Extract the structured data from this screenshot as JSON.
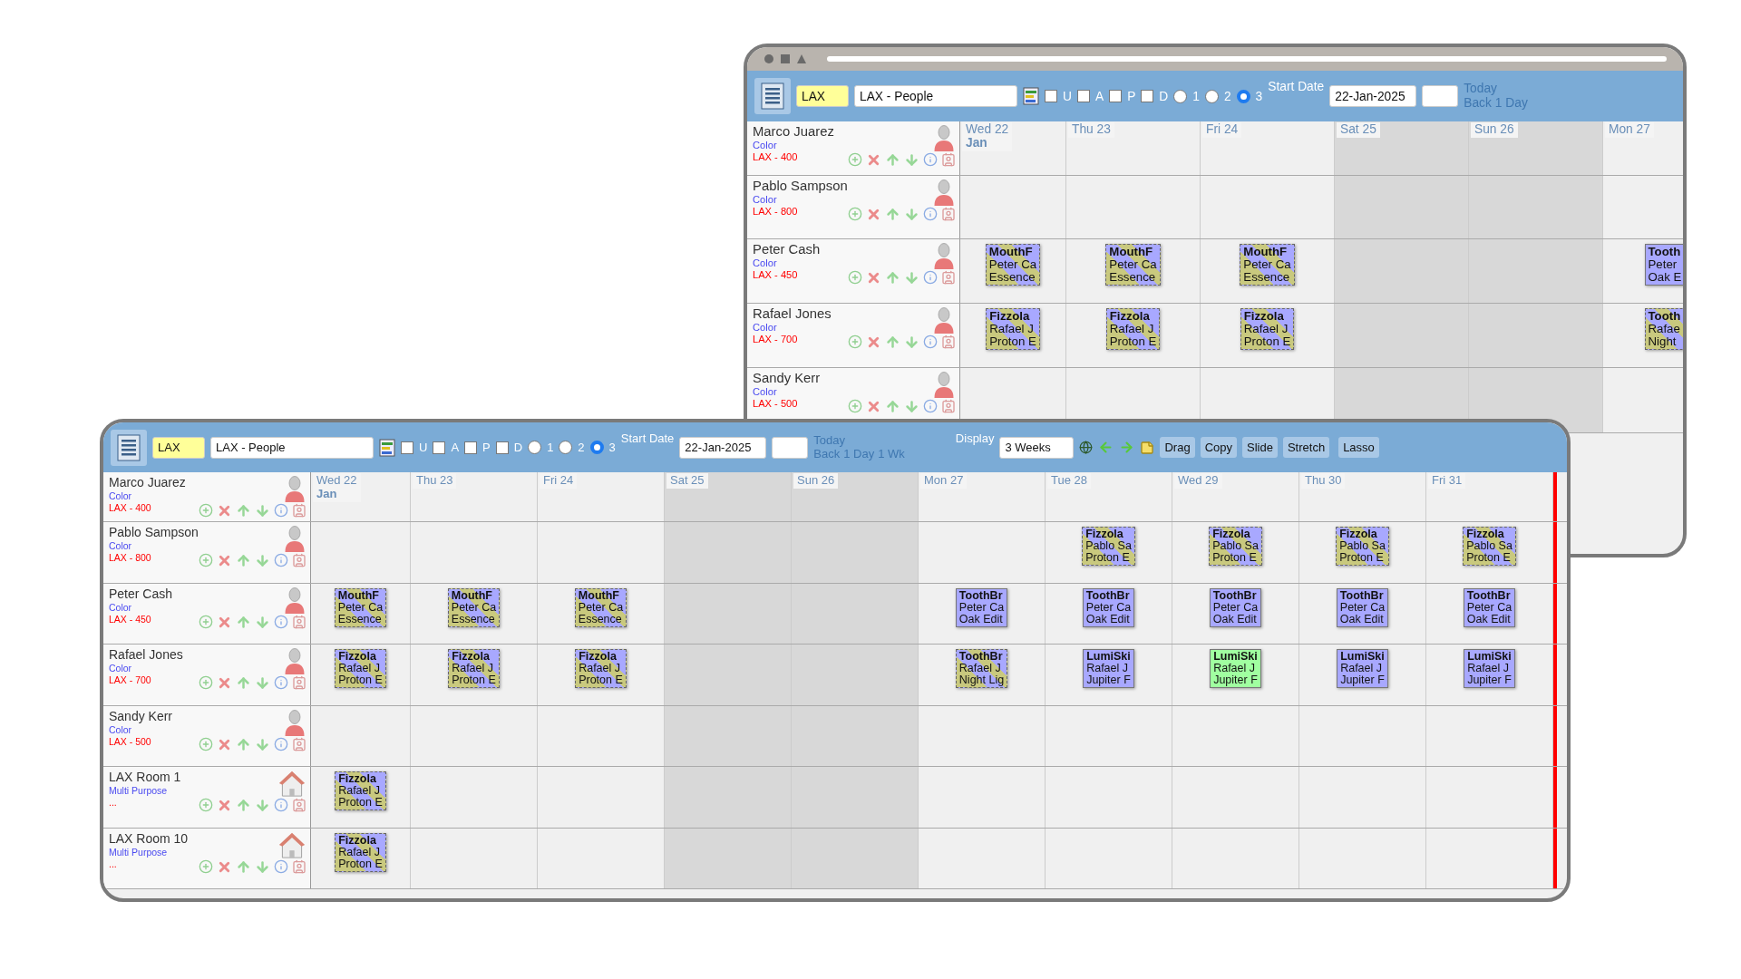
{
  "windows": [
    {
      "title_bar": true,
      "toolbar": {
        "code": "LAX",
        "view": "LAX - People",
        "filters": [
          {
            "label": "U",
            "checked": false
          },
          {
            "label": "A",
            "checked": false
          },
          {
            "label": "P",
            "checked": false
          },
          {
            "label": "D",
            "checked": false
          }
        ],
        "radios": [
          {
            "label": "1",
            "selected": false
          },
          {
            "label": "2",
            "selected": false
          },
          {
            "label": "3",
            "selected": true
          }
        ],
        "start_label": "Start Date",
        "start_date": "22-Jan-2025",
        "today_link": "Today",
        "back_links": [
          "Back",
          "1 Day"
        ]
      },
      "days": [
        {
          "label": "Wed 22",
          "month": "Jan",
          "weekend": false
        },
        {
          "label": "Thu 23",
          "weekend": false
        },
        {
          "label": "Fri 24",
          "weekend": false
        },
        {
          "label": "Sat 25",
          "weekend": true
        },
        {
          "label": "Sun 26",
          "weekend": true
        },
        {
          "label": "Mon 27",
          "weekend": false
        }
      ],
      "rows": [
        {
          "name": "Marco Juarez",
          "sub": "Color",
          "tag": "LAX - 400",
          "kind": "person",
          "slots": [
            {
              "kind": "none"
            },
            {
              "kind": "none"
            },
            {
              "kind": "none"
            },
            {
              "kind": "none"
            },
            {
              "kind": "none"
            },
            {
              "kind": "none"
            }
          ]
        },
        {
          "name": "Pablo Sampson",
          "sub": "Color",
          "tag": "LAX - 800",
          "kind": "person",
          "slots": [
            {
              "kind": "none"
            },
            {
              "kind": "none"
            },
            {
              "kind": "none"
            },
            {
              "kind": "none"
            },
            {
              "kind": "none"
            },
            {
              "kind": "none"
            }
          ]
        },
        {
          "name": "Peter Cash",
          "sub": "Color",
          "tag": "LAX - 450",
          "kind": "person",
          "slots": [
            {
              "lines": [
                "MouthF",
                "Peter Ca",
                "Essence"
              ],
              "kind": "striped"
            },
            {
              "lines": [
                "MouthF",
                "Peter Ca",
                "Essence"
              ],
              "kind": "striped"
            },
            {
              "lines": [
                "MouthF",
                "Peter Ca",
                "Essence"
              ],
              "kind": "striped"
            },
            {
              "kind": "none"
            },
            {
              "kind": "none"
            },
            {
              "lines": [
                "Tooth",
                "Peter",
                "Oak E"
              ],
              "kind": "solid",
              "color": "#a8a8ff"
            }
          ]
        },
        {
          "name": "Rafael Jones",
          "sub": "Color",
          "tag": "LAX - 700",
          "kind": "person",
          "slots": [
            {
              "lines": [
                "Fizzola",
                "Rafael J",
                "Proton E"
              ],
              "kind": "striped"
            },
            {
              "lines": [
                "Fizzola",
                "Rafael J",
                "Proton E"
              ],
              "kind": "striped"
            },
            {
              "lines": [
                "Fizzola",
                "Rafael J",
                "Proton E"
              ],
              "kind": "striped"
            },
            {
              "kind": "none"
            },
            {
              "kind": "none"
            },
            {
              "lines": [
                "Tooth",
                "Rafae",
                "Night"
              ],
              "kind": "striped"
            }
          ]
        },
        {
          "name": "Sandy Kerr",
          "sub": "Color",
          "tag": "LAX - 500",
          "kind": "person",
          "slots": [
            {
              "kind": "none"
            },
            {
              "kind": "none"
            },
            {
              "kind": "none"
            },
            {
              "kind": "none"
            },
            {
              "kind": "none"
            },
            {
              "kind": "none"
            }
          ]
        }
      ]
    },
    {
      "toolbar": {
        "code": "LAX",
        "view": "LAX - People",
        "filters": [
          {
            "label": "U",
            "checked": false
          },
          {
            "label": "A",
            "checked": false
          },
          {
            "label": "P",
            "checked": false
          },
          {
            "label": "D",
            "checked": false
          }
        ],
        "radios": [
          {
            "label": "1",
            "selected": false
          },
          {
            "label": "2",
            "selected": false
          },
          {
            "label": "3",
            "selected": true
          }
        ],
        "start_label": "Start Date",
        "start_date": "22-Jan-2025",
        "today_link": "Today",
        "back_links": [
          "Back",
          "1 Day",
          "1 Wk"
        ],
        "display_label": "Display",
        "display_value": "3 Weeks",
        "buttons": [
          "Drag",
          "Copy",
          "Slide",
          "Stretch",
          "Lasso"
        ]
      },
      "days": [
        {
          "label": "Wed 22",
          "month": "Jan",
          "weekend": false
        },
        {
          "label": "Thu 23",
          "weekend": false
        },
        {
          "label": "Fri 24",
          "weekend": false
        },
        {
          "label": "Sat 25",
          "weekend": true
        },
        {
          "label": "Sun 26",
          "weekend": true
        },
        {
          "label": "Mon 27",
          "weekend": false
        },
        {
          "label": "Tue 28",
          "weekend": false
        },
        {
          "label": "Wed 29",
          "weekend": false
        },
        {
          "label": "Thu 30",
          "weekend": false
        },
        {
          "label": "Fri 31",
          "weekend": false
        }
      ],
      "rows": [
        {
          "name": "Marco Juarez",
          "sub": "Color",
          "tag": "LAX - 400",
          "kind": "person",
          "slots": [
            {
              "kind": "none"
            },
            {
              "kind": "none"
            },
            {
              "kind": "none"
            },
            {
              "kind": "none"
            },
            {
              "kind": "none"
            },
            {
              "kind": "none"
            },
            {
              "kind": "none"
            },
            {
              "kind": "none"
            },
            {
              "kind": "none"
            },
            {
              "kind": "none"
            }
          ]
        },
        {
          "name": "Pablo Sampson",
          "sub": "Color",
          "tag": "LAX - 800",
          "kind": "person",
          "slots": [
            {
              "kind": "none"
            },
            {
              "kind": "none"
            },
            {
              "kind": "none"
            },
            {
              "kind": "none"
            },
            {
              "kind": "none"
            },
            {
              "kind": "none"
            },
            {
              "lines": [
                "Fizzola",
                "Pablo Sa",
                "Proton E"
              ],
              "kind": "striped"
            },
            {
              "lines": [
                "Fizzola",
                "Pablo Sa",
                "Proton E"
              ],
              "kind": "striped"
            },
            {
              "lines": [
                "Fizzola",
                "Pablo Sa",
                "Proton E"
              ],
              "kind": "striped"
            },
            {
              "lines": [
                "Fizzola",
                "Pablo Sa",
                "Proton E"
              ],
              "kind": "striped"
            }
          ]
        },
        {
          "name": "Peter Cash",
          "sub": "Color",
          "tag": "LAX - 450",
          "kind": "person",
          "slots": [
            {
              "lines": [
                "MouthF",
                "Peter Ca",
                "Essence"
              ],
              "kind": "striped"
            },
            {
              "lines": [
                "MouthF",
                "Peter Ca",
                "Essence"
              ],
              "kind": "striped"
            },
            {
              "lines": [
                "MouthF",
                "Peter Ca",
                "Essence"
              ],
              "kind": "striped"
            },
            {
              "kind": "none"
            },
            {
              "kind": "none"
            },
            {
              "lines": [
                "ToothBr",
                "Peter Ca",
                "Oak Edit"
              ],
              "kind": "solid",
              "color": "#a8a8ff"
            },
            {
              "lines": [
                "ToothBr",
                "Peter Ca",
                "Oak Edit"
              ],
              "kind": "solid",
              "color": "#a8a8ff"
            },
            {
              "lines": [
                "ToothBr",
                "Peter Ca",
                "Oak Edit"
              ],
              "kind": "solid",
              "color": "#a8a8ff"
            },
            {
              "lines": [
                "ToothBr",
                "Peter Ca",
                "Oak Edit"
              ],
              "kind": "solid",
              "color": "#a8a8ff"
            },
            {
              "lines": [
                "ToothBr",
                "Peter Ca",
                "Oak Edit"
              ],
              "kind": "solid",
              "color": "#a8a8ff"
            }
          ]
        },
        {
          "name": "Rafael Jones",
          "sub": "Color",
          "tag": "LAX - 700",
          "kind": "person",
          "slots": [
            {
              "lines": [
                "Fizzola",
                "Rafael J",
                "Proton E"
              ],
              "kind": "striped"
            },
            {
              "lines": [
                "Fizzola",
                "Rafael J",
                "Proton E"
              ],
              "kind": "striped"
            },
            {
              "lines": [
                "Fizzola",
                "Rafael J",
                "Proton E"
              ],
              "kind": "striped"
            },
            {
              "kind": "none"
            },
            {
              "kind": "none"
            },
            {
              "lines": [
                "ToothBr",
                "Rafael J",
                "Night Lig"
              ],
              "kind": "striped"
            },
            {
              "lines": [
                "LumiSki",
                "Rafael J",
                "Jupiter F"
              ],
              "kind": "solid",
              "color": "#a8a8ff"
            },
            {
              "lines": [
                "LumiSki",
                "Rafael J",
                "Jupiter F"
              ],
              "kind": "solid",
              "color": "#a0ffa0"
            },
            {
              "lines": [
                "LumiSki",
                "Rafael J",
                "Jupiter F"
              ],
              "kind": "solid",
              "color": "#a8a8ff"
            },
            {
              "lines": [
                "LumiSki",
                "Rafael J",
                "Jupiter F"
              ],
              "kind": "solid",
              "color": "#a8a8ff"
            }
          ]
        },
        {
          "name": "Sandy Kerr",
          "sub": "Color",
          "tag": "LAX - 500",
          "kind": "person",
          "slots": [
            {
              "kind": "none"
            },
            {
              "kind": "none"
            },
            {
              "kind": "none"
            },
            {
              "kind": "none"
            },
            {
              "kind": "none"
            },
            {
              "kind": "none"
            },
            {
              "kind": "none"
            },
            {
              "kind": "none"
            },
            {
              "kind": "none"
            },
            {
              "kind": "none"
            }
          ]
        },
        {
          "name": "LAX Room 1",
          "sub": "Multi Purpose",
          "tag": "...",
          "kind": "room",
          "slots": [
            {
              "lines": [
                "Fizzola",
                "Rafael J",
                "Proton E"
              ],
              "kind": "striped"
            },
            {
              "kind": "none"
            },
            {
              "kind": "none"
            },
            {
              "kind": "none"
            },
            {
              "kind": "none"
            },
            {
              "kind": "none"
            },
            {
              "kind": "none"
            },
            {
              "kind": "none"
            },
            {
              "kind": "none"
            },
            {
              "kind": "none"
            }
          ]
        },
        {
          "name": "LAX Room 10",
          "sub": "Multi Purpose",
          "tag": "...",
          "kind": "room",
          "slots": [
            {
              "lines": [
                "Fizzola",
                "Rafael J",
                "Proton E"
              ],
              "kind": "striped"
            },
            {
              "kind": "none"
            },
            {
              "kind": "none"
            },
            {
              "kind": "none"
            },
            {
              "kind": "none"
            },
            {
              "kind": "none"
            },
            {
              "kind": "none"
            },
            {
              "kind": "none"
            },
            {
              "kind": "none"
            },
            {
              "kind": "none"
            }
          ]
        }
      ]
    }
  ]
}
